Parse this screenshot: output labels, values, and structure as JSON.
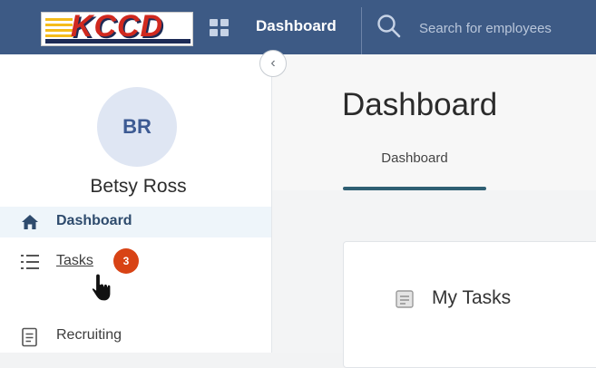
{
  "header": {
    "logo_text": "KCCD",
    "title": "Dashboard",
    "search_placeholder": "Search for employees",
    "bar_color": "#3d5a85"
  },
  "sidebar": {
    "avatar_initials": "BR",
    "user_name": "Betsy Ross",
    "collapse_icon": "chevron-left-icon",
    "items": [
      {
        "label": "Dashboard",
        "icon": "home-icon",
        "active": true
      },
      {
        "label": "Tasks",
        "icon": "tasks-list-icon",
        "badge": "3"
      },
      {
        "label": "Recruiting",
        "icon": "document-icon"
      }
    ]
  },
  "main": {
    "page_title": "Dashboard",
    "tabs": [
      {
        "label": "Dashboard",
        "active": true
      }
    ],
    "card": {
      "title": "My Tasks",
      "icon": "tasks-card-icon"
    }
  },
  "colors": {
    "accent": "#2f5f73",
    "badge": "#d84315",
    "avatar_bg": "#dfe6f3"
  }
}
